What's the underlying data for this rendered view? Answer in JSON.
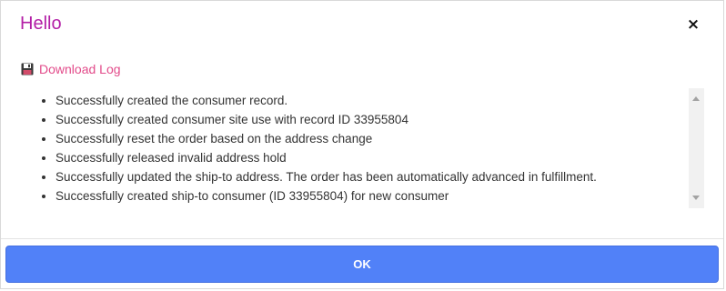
{
  "dialog": {
    "title": "Hello",
    "close_label": "×",
    "title_color": "#b31fa6"
  },
  "download": {
    "icon": "floppy-disk-icon",
    "label": "Download Log",
    "color": "#e24b8a"
  },
  "log": {
    "items": [
      "Successfully created the consumer record.",
      "Successfully created consumer site use with record ID 33955804",
      "Successfully reset the order based on the address change",
      "Successfully released invalid address hold",
      "Successfully updated the ship-to address. The order has been automatically advanced in fulfillment.",
      "Successfully created ship-to consumer (ID 33955804) for new consumer"
    ]
  },
  "footer": {
    "ok_label": "OK",
    "ok_color": "#5181f8"
  }
}
